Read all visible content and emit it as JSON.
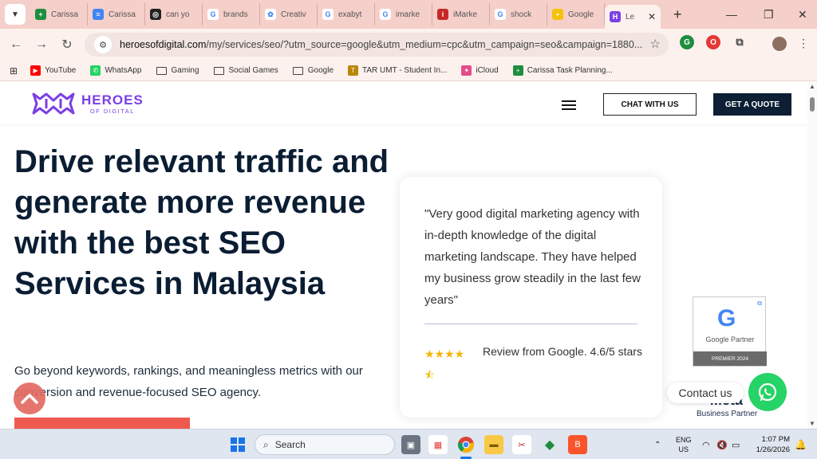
{
  "browser": {
    "tabs": [
      {
        "label": "Carissa",
        "color": "#1e8e3e",
        "glyph": "+"
      },
      {
        "label": "Carissa",
        "color": "#4285f4",
        "glyph": "≡"
      },
      {
        "label": "can yo",
        "color": "#222222",
        "glyph": "◎"
      },
      {
        "label": "brands",
        "color": "#ffffff",
        "glyph": "G"
      },
      {
        "label": "Creativ",
        "color": "#ffffff",
        "glyph": "✿"
      },
      {
        "label": "exabyt",
        "color": "#ffffff",
        "glyph": "G"
      },
      {
        "label": "imarke",
        "color": "#ffffff",
        "glyph": "G"
      },
      {
        "label": "iMarke",
        "color": "#c62828",
        "glyph": "i"
      },
      {
        "label": "shock",
        "color": "#ffffff",
        "glyph": "G"
      },
      {
        "label": "Google",
        "color": "#f4c20d",
        "glyph": "•"
      },
      {
        "label": "Le",
        "color": "#7b3fe4",
        "glyph": "H",
        "active": true
      }
    ],
    "url_domain": "heroesofdigital.com",
    "url_rest": "/my/services/seo/?utm_source=google&utm_medium=cpc&utm_campaign=seo&campaign=1880...",
    "bookmarks": [
      {
        "label": "YouTube",
        "type": "icon",
        "color": "#ff0000",
        "glyph": "▶"
      },
      {
        "label": "WhatsApp",
        "type": "icon",
        "color": "#25d366",
        "glyph": "✆"
      },
      {
        "label": "Gaming",
        "type": "folder"
      },
      {
        "label": "Social Games",
        "type": "folder"
      },
      {
        "label": "Google",
        "type": "folder"
      },
      {
        "label": "TAR UMT - Student In...",
        "type": "icon",
        "color": "#b8860b",
        "glyph": "T"
      },
      {
        "label": "iCloud",
        "type": "icon",
        "color": "#e44c8c",
        "glyph": "✦"
      },
      {
        "label": "Carissa Task Planning...",
        "type": "icon",
        "color": "#1e8e3e",
        "glyph": "+"
      }
    ]
  },
  "site": {
    "logo_main": "HEROES",
    "logo_sub": "OF DIGITAL",
    "chat_button": "CHAT WITH US",
    "quote_button": "GET A QUOTE",
    "hero_title": "Drive relevant traffic and generate more revenue with the best SEO Services in Malaysia",
    "hero_subtitle": "Go beyond keywords, rankings, and meaningless metrics with our conversion and revenue-focused SEO agency.",
    "review_quote": "\"Very good digital marketing agency with in-depth knowledge of the digital marketing landscape. They have helped my business grow steadily in the last few years\"",
    "review_rating": 4.5,
    "review_stars_text": "★★★★ ⯪",
    "review_source": "Review from Google. 4.6/5 stars",
    "google_partner": {
      "label": "Google Partner",
      "footer": "PREMIER 2024",
      "letter": "G"
    },
    "contact_label": "Contact us",
    "meta_logo": "∞ Meta",
    "meta_sub": "Business Partner"
  },
  "taskbar": {
    "search_placeholder": "Search",
    "language_top": "ENG",
    "language_bottom": "US",
    "time": "1:07 PM",
    "date": "1/26/2026"
  }
}
